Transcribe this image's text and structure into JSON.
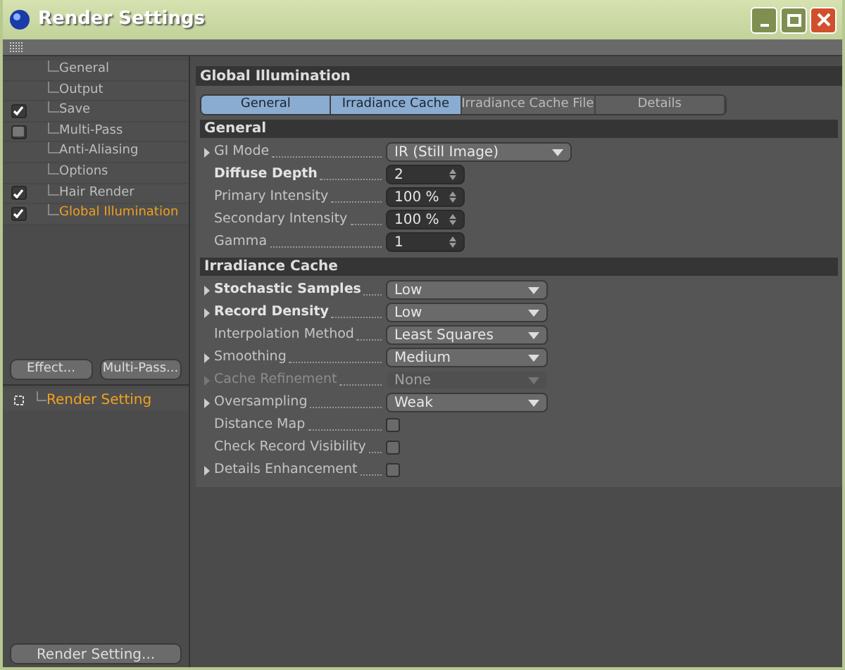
{
  "window": {
    "title": "Render Settings"
  },
  "sidebar": {
    "items": [
      {
        "label": "General",
        "selected": false
      },
      {
        "label": "Output",
        "selected": false
      },
      {
        "label": "Save",
        "selected": false,
        "checked": true
      },
      {
        "label": "Multi-Pass",
        "selected": false,
        "checked": false
      },
      {
        "label": "Anti-Aliasing",
        "selected": false
      },
      {
        "label": "Options",
        "selected": false
      },
      {
        "label": "Hair Render",
        "selected": false,
        "checked": true
      },
      {
        "label": "Global Illumination",
        "selected": true,
        "checked": true
      }
    ],
    "buttons": [
      "Effect...",
      "Multi-Pass..."
    ],
    "presets": [
      {
        "label": "Render Setting",
        "selected": true
      }
    ],
    "footer_button": "Render Setting..."
  },
  "panel": {
    "title": "Global Illumination",
    "tabs": [
      {
        "label": "General",
        "selected": true
      },
      {
        "label": "Irradiance Cache",
        "selected": true
      },
      {
        "label": "Irradiance Cache File",
        "selected": false
      },
      {
        "label": "Details",
        "selected": false
      }
    ],
    "sections": [
      {
        "title": "General",
        "params": [
          {
            "label": "GI Mode",
            "kind": "dropdown",
            "value": "IR (Still Image)",
            "bold": false,
            "expandable": true,
            "disabled": false,
            "wide": true
          },
          {
            "label": "Diffuse Depth",
            "kind": "spinner",
            "value": "2",
            "bold": true,
            "expandable": false,
            "disabled": false
          },
          {
            "label": "Primary Intensity",
            "kind": "spinner",
            "value": "100 %",
            "bold": false,
            "expandable": false,
            "disabled": false
          },
          {
            "label": "Secondary Intensity",
            "kind": "spinner",
            "value": "100 %",
            "bold": false,
            "expandable": false,
            "disabled": false
          },
          {
            "label": "Gamma",
            "kind": "spinner",
            "value": "1",
            "bold": false,
            "expandable": false,
            "disabled": false
          }
        ]
      },
      {
        "title": "Irradiance Cache",
        "params": [
          {
            "label": "Stochastic Samples",
            "kind": "dropdown",
            "value": "Low",
            "bold": true,
            "expandable": true,
            "disabled": false
          },
          {
            "label": "Record Density",
            "kind": "dropdown",
            "value": "Low",
            "bold": true,
            "expandable": true,
            "disabled": false
          },
          {
            "label": "Interpolation Method",
            "kind": "dropdown",
            "value": "Least Squares",
            "bold": false,
            "expandable": false,
            "disabled": false
          },
          {
            "label": "Smoothing",
            "kind": "dropdown",
            "value": "Medium",
            "bold": false,
            "expandable": true,
            "disabled": false
          },
          {
            "label": "Cache Refinement",
            "kind": "dropdown",
            "value": "None",
            "bold": false,
            "expandable": true,
            "disabled": true
          },
          {
            "label": "Oversampling",
            "kind": "dropdown",
            "value": "Weak",
            "bold": false,
            "expandable": true,
            "disabled": false
          },
          {
            "label": "Distance Map",
            "kind": "checkbox",
            "checked": false,
            "bold": false,
            "expandable": false,
            "disabled": false
          },
          {
            "label": "Check Record Visibility",
            "kind": "checkbox",
            "checked": false,
            "bold": false,
            "expandable": false,
            "disabled": false
          },
          {
            "label": "Details Enhancement",
            "kind": "checkbox",
            "checked": false,
            "bold": false,
            "expandable": true,
            "disabled": false
          }
        ]
      }
    ]
  }
}
